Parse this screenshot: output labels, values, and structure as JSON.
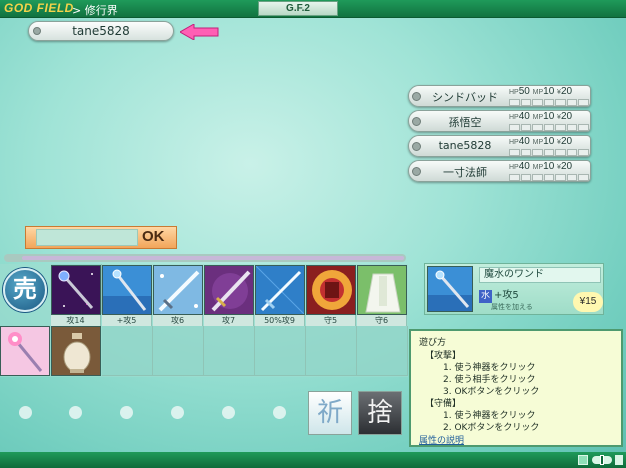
{
  "header": {
    "logo": "GOD FIELD",
    "breadcrumb": "> 修行界",
    "badge": "G.F.2"
  },
  "player": {
    "name": "tane5828"
  },
  "opponents": [
    {
      "name": "シンドバッド",
      "hp": "50",
      "mp": "10",
      "gold": "20"
    },
    {
      "name": "孫悟空",
      "hp": "40",
      "mp": "10",
      "gold": "20"
    },
    {
      "name": "tane5828",
      "hp": "40",
      "mp": "10",
      "gold": "20"
    },
    {
      "name": "一寸法師",
      "hp": "40",
      "mp": "10",
      "gold": "20"
    }
  ],
  "stat_labels": {
    "hp": "HP",
    "mp": "MP",
    "gold": "¥"
  },
  "ok_button": "OK",
  "sell_icon": "売",
  "hand": [
    {
      "name": "magic-staff-card",
      "label": "攻14"
    },
    {
      "name": "water-wand-card",
      "label": "+攻5"
    },
    {
      "name": "ice-sword-card",
      "label": "攻6"
    },
    {
      "name": "dark-sword-card",
      "label": "攻7"
    },
    {
      "name": "crystal-spear-card",
      "label": "50%攻9"
    },
    {
      "name": "red-armor-card",
      "label": "守5"
    },
    {
      "name": "white-robe-card",
      "label": "守6"
    }
  ],
  "hand_row2": [
    {
      "name": "pink-staff-card"
    },
    {
      "name": "urn-card"
    }
  ],
  "detail": {
    "name": "魔水のワンド",
    "attribute": "水",
    "effect": "+攻5",
    "sub": "属性を加える",
    "price": "¥15"
  },
  "help": {
    "title": "遊び方",
    "attack_head": "【攻撃】",
    "attack_steps": [
      "1. 使う神器をクリック",
      "2. 使う相手をクリック",
      "3. OKボタンをクリック"
    ],
    "defend_head": "【守備】",
    "defend_steps": [
      "1. 使う神器をクリック",
      "2. OKボタンをクリック"
    ],
    "link": "属性の説明"
  },
  "actions": {
    "pray": "祈",
    "discard": "捨"
  },
  "colors": {
    "accent_pink": "#ff5fb4",
    "header_green": "#1f9a5a"
  }
}
